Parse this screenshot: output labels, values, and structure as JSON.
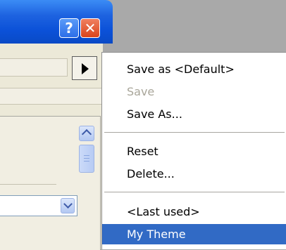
{
  "window": {
    "help_button_label": "?",
    "close_button_label": "✕"
  },
  "menu": {
    "items": [
      {
        "label": "Save as <Default>",
        "enabled": true,
        "selected": false
      },
      {
        "label": "Save",
        "enabled": false,
        "selected": false
      },
      {
        "label": "Save As...",
        "enabled": true,
        "selected": false
      },
      {
        "label": "Reset",
        "enabled": true,
        "selected": false
      },
      {
        "label": "Delete...",
        "enabled": true,
        "selected": false
      },
      {
        "label": "<Last used>",
        "enabled": true,
        "selected": false
      },
      {
        "label": "My Theme",
        "enabled": true,
        "selected": true
      }
    ]
  },
  "colors": {
    "title_bar": "#0a4ac6",
    "highlight": "#316ac5",
    "disabled_text": "#a9a69a",
    "client_background": "#ece9d8"
  }
}
